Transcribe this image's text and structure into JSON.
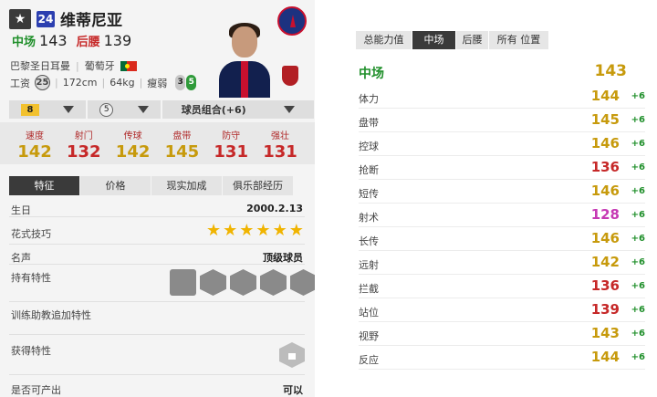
{
  "player": {
    "star_icon": "★",
    "season_badge": "24",
    "name": "维蒂尼亚",
    "main_position": "中场",
    "main_rating": "143",
    "alt_position": "后腰",
    "alt_rating": "139",
    "club": "巴黎圣日耳曼",
    "nationality": "葡萄牙",
    "salary_label": "工资",
    "salary": "25",
    "height": "172cm",
    "weight": "64kg",
    "weak_foot_label": "瘦弱",
    "left_foot": "3",
    "right_foot": "5"
  },
  "controls": {
    "level": "8",
    "team_level": "5",
    "combo_label": "球员组合(+6)"
  },
  "main_stats": [
    {
      "label": "速度",
      "value": "142",
      "color": "#c79a0c"
    },
    {
      "label": "射门",
      "value": "132",
      "color": "#c62828"
    },
    {
      "label": "传球",
      "value": "142",
      "color": "#c79a0c"
    },
    {
      "label": "盘带",
      "value": "145",
      "color": "#c79a0c"
    },
    {
      "label": "防守",
      "value": "131",
      "color": "#c62828"
    },
    {
      "label": "强壮",
      "value": "131",
      "color": "#c62828"
    }
  ],
  "tabs": [
    "特征",
    "价格",
    "现实加成",
    "俱乐部经历"
  ],
  "details": {
    "birth_label": "生日",
    "birth_value": "2000.2.13",
    "skill_label": "花式技巧",
    "fame_label": "名声",
    "fame_value": "顶级球员",
    "traits_label": "持有特性",
    "training_label": "训练助教追加特性",
    "acquired_label": "获得特性",
    "produce_label": "是否可产出",
    "produce_value": "可以"
  },
  "right": {
    "tabs": [
      "总能力值",
      "中场",
      "后腰",
      "所有 位置"
    ],
    "position_name": "中场",
    "position_value": "143",
    "bonus": "+6",
    "attributes": [
      {
        "name": "体力",
        "value": "144",
        "color": "#c79a0c"
      },
      {
        "name": "盘带",
        "value": "145",
        "color": "#c79a0c"
      },
      {
        "name": "控球",
        "value": "146",
        "color": "#c79a0c"
      },
      {
        "name": "抢断",
        "value": "136",
        "color": "#c62828"
      },
      {
        "name": "短传",
        "value": "146",
        "color": "#c79a0c"
      },
      {
        "name": "射术",
        "value": "128",
        "color": "#c639b4"
      },
      {
        "name": "长传",
        "value": "146",
        "color": "#c79a0c"
      },
      {
        "name": "远射",
        "value": "142",
        "color": "#c79a0c"
      },
      {
        "name": "拦截",
        "value": "136",
        "color": "#c62828"
      },
      {
        "name": "站位",
        "value": "139",
        "color": "#c62828"
      },
      {
        "name": "视野",
        "value": "143",
        "color": "#c79a0c"
      },
      {
        "name": "反应",
        "value": "144",
        "color": "#c79a0c"
      }
    ]
  }
}
